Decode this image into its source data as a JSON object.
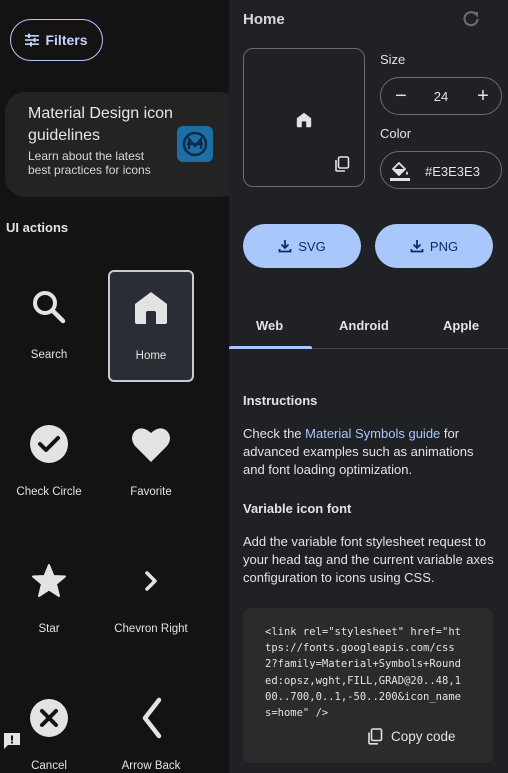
{
  "filters": {
    "label": "Filters"
  },
  "guide": {
    "title": "Material Design icon guidelines",
    "subtitle": "Learn about the latest best practices for icons"
  },
  "section_title": "UI actions",
  "icons": [
    {
      "label": "Search",
      "icon": "search-icon"
    },
    {
      "label": "Home",
      "icon": "home-icon",
      "selected": true
    },
    {
      "label": "Check Circle",
      "icon": "check-circle-icon"
    },
    {
      "label": "Favorite",
      "icon": "favorite-icon"
    },
    {
      "label": "Star",
      "icon": "star-icon"
    },
    {
      "label": "Chevron Right",
      "icon": "chevron-right-icon"
    },
    {
      "label": "Cancel",
      "icon": "cancel-icon"
    },
    {
      "label": "Arrow Back",
      "icon": "arrow-back-icon"
    }
  ],
  "detail": {
    "title": "Home",
    "size_label": "Size",
    "size_value": "24",
    "color_label": "Color",
    "color_value": "#E3E3E3",
    "svg_label": "SVG",
    "png_label": "PNG",
    "tabs": [
      "Web",
      "Android",
      "Apple"
    ],
    "active_tab": "Web",
    "instructions_title": "Instructions",
    "instructions_pre": "Check the ",
    "instructions_link": "Material Symbols guide",
    "instructions_post": " for advanced examples such as animations and font loading optimization.",
    "variable_title": "Variable icon font",
    "variable_text": "Add the variable font stylesheet request to your head tag and the current variable axes configuration to icons using CSS.",
    "code_lines": [
      "<link rel=\"stylesheet\" href=\"ht",
      "tps://fonts.googleapis.com/css",
      "2?family=Material+Symbols+Round",
      "ed:opsz,wght,FILL,GRAD@20..48,1",
      "00..700,0..1,-50..200&icon_name",
      "s=home\" />"
    ],
    "copy_code_label": "Copy code"
  },
  "colors": {
    "accent": "#a8c7fa",
    "icon": "#e3e3e3",
    "background": "#131313"
  }
}
